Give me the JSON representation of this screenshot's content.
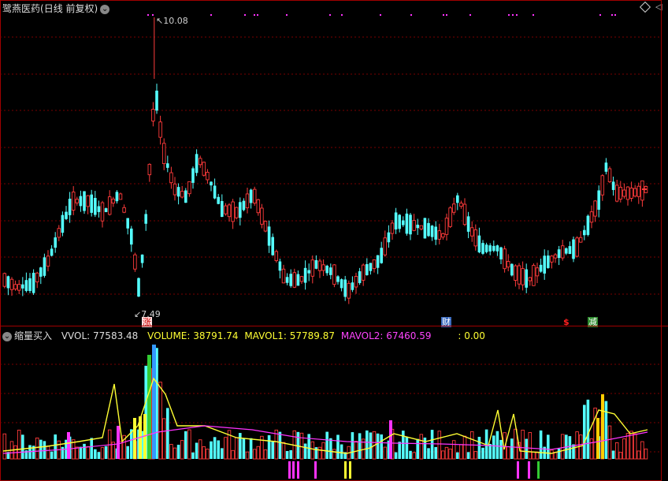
{
  "stock_name": "鹭燕医药",
  "mode_label": "(日线 前复权)",
  "price_panel": {
    "high_label": "10.08",
    "low_label": "7.49",
    "tag_zhang": "涨",
    "tag_cai": "财",
    "tag_dollar": "$",
    "tag_jian": "减"
  },
  "indicator_panel": {
    "name": "缩量买入",
    "vol": "VVOL: 77583.48",
    "volume": "VOLUME: 38791.74",
    "mavol1": "MAVOL1: 57789.87",
    "mavol2": "MAVOL2: 67460.59",
    "extra": ": 0.00"
  },
  "colors": {
    "up": "#ff3b3b",
    "down": "#54ffff",
    "ma1": "#ffff33",
    "ma2": "#ff33ff",
    "grid": "#7a0000",
    "yellow_label": "#ffff33",
    "magenta_label": "#ff44ff"
  },
  "icons": {
    "collapse": "chevron-down-icon",
    "settings": "diamond-icon",
    "panel": "arrow-icon"
  }
}
